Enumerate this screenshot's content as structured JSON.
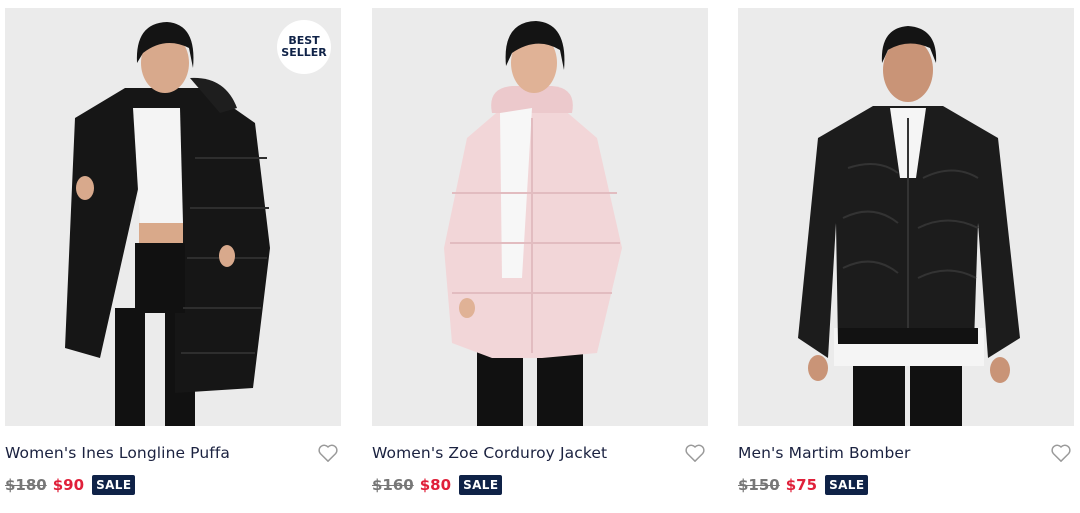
{
  "products": [
    {
      "title": "Women's Ines Longline Puffa",
      "original_price": "$180",
      "sale_price": "$90",
      "sale_label": "SALE",
      "badge_line1": "BEST",
      "badge_line2": "SELLER",
      "jacket_color": "#121212"
    },
    {
      "title": "Women's Zoe Corduroy Jacket",
      "original_price": "$160",
      "sale_price": "$80",
      "sale_label": "SALE",
      "jacket_color": "#f2d6d8"
    },
    {
      "title": "Men's Martim Bomber",
      "original_price": "$150",
      "sale_price": "$75",
      "sale_label": "SALE",
      "jacket_color": "#1a1a1a"
    }
  ],
  "colors": {
    "title_text": "#1b2240",
    "sale_price": "#e0203a",
    "sale_badge_bg": "#0f2247",
    "image_bg": "#ebebeb"
  },
  "icons": {
    "wishlist": "heart-outline-icon"
  }
}
